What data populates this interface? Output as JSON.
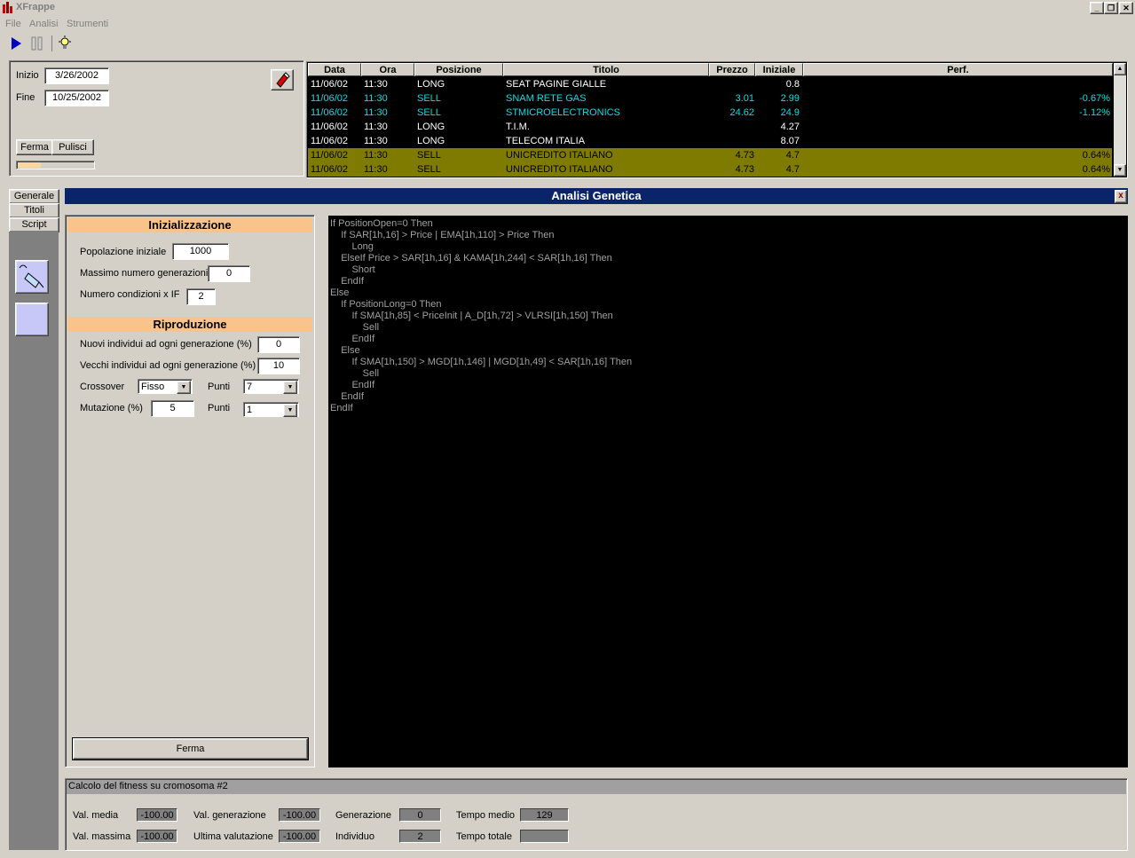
{
  "window": {
    "title": "XFrappe"
  },
  "menu": [
    "File",
    "Analisi",
    "Strumenti"
  ],
  "controls": {
    "inizio_label": "Inizio",
    "inizio_value": "3/26/2002",
    "fine_label": "Fine",
    "fine_value": "10/25/2002",
    "ferma_label": "Ferma",
    "pulisci_label": "Pulisci",
    "progress": 0.3
  },
  "ticker": {
    "columns": [
      "Data",
      "Ora",
      "Posizione",
      "Titolo",
      "Prezzo",
      "Iniziale",
      "Perf."
    ],
    "rows": [
      {
        "data": "11/06/02",
        "ora": "11:30",
        "pos": "LONG",
        "titolo": "SEAT PAGINE GIALLE",
        "prezzo": "",
        "iniziale": "0.8",
        "perf": "",
        "color": "#ffffff",
        "highlight": false
      },
      {
        "data": "11/06/02",
        "ora": "11:30",
        "pos": "SELL",
        "titolo": "SNAM RETE GAS",
        "prezzo": "3.01",
        "iniziale": "2.99",
        "perf": "-0.67%",
        "color": "#00e0e0",
        "highlight": false
      },
      {
        "data": "11/06/02",
        "ora": "11:30",
        "pos": "SELL",
        "titolo": "STMICROELECTRONICS",
        "prezzo": "24.62",
        "iniziale": "24.9",
        "perf": "-1.12%",
        "color": "#00e0e0",
        "highlight": false
      },
      {
        "data": "11/06/02",
        "ora": "11:30",
        "pos": "LONG",
        "titolo": "T.I.M.",
        "prezzo": "",
        "iniziale": "4.27",
        "perf": "",
        "color": "#ffffff",
        "highlight": false
      },
      {
        "data": "11/06/02",
        "ora": "11:30",
        "pos": "LONG",
        "titolo": "TELECOM ITALIA",
        "prezzo": "",
        "iniziale": "8.07",
        "perf": "",
        "color": "#ffffff",
        "highlight": false
      },
      {
        "data": "11/06/02",
        "ora": "11:30",
        "pos": "SELL",
        "titolo": "UNICREDITO ITALIANO",
        "prezzo": "4.73",
        "iniziale": "4.7",
        "perf": "0.64%",
        "color": "#000000",
        "highlight": true
      },
      {
        "data": "11/06/02",
        "ora": "11:30",
        "pos": "SELL",
        "titolo": "UNICREDITO ITALIANO",
        "prezzo": "4.73",
        "iniziale": "4.7",
        "perf": "0.64%",
        "color": "#000000",
        "highlight": true
      }
    ]
  },
  "side_tabs": [
    "Generale",
    "Titoli",
    "Script"
  ],
  "panel": {
    "title": "Analisi Genetica",
    "close_label": "x",
    "init_header": "Inizializzazione",
    "popolazione_label": "Popolazione iniziale",
    "popolazione_value": "1000",
    "max_gen_label": "Massimo numero generazioni",
    "max_gen_value": "0",
    "num_cond_label": "Numero condizioni x IF",
    "num_cond_value": "2",
    "repro_header": "Riproduzione",
    "nuovi_label": "Nuovi individui ad ogni generazione (%)",
    "nuovi_value": "0",
    "vecchi_label": "Vecchi individui ad ogni generazione (%)",
    "vecchi_value": "10",
    "crossover_label": "Crossover",
    "crossover_value": "Fisso",
    "punti1_label": "Punti",
    "punti1_value": "7",
    "mutazione_label": "Mutazione (%)",
    "mutazione_value": "5",
    "punti2_label": "Punti",
    "punti2_value": "1",
    "ferma_label": "Ferma"
  },
  "code": "If PositionOpen=0 Then\n    If SAR[1h,16] > Price | EMA[1h,110] > Price Then\n        Long\n    ElseIf Price > SAR[1h,16] & KAMA[1h,244] < SAR[1h,16] Then\n        Short\n    EndIf\nElse\n    If PositionLong=0 Then\n        If SMA[1h,85] < PriceInit | A_D[1h,72] > VLRSI[1h,150] Then\n            Sell\n        EndIf\n    Else\n        If SMA[1h,150] > MGD[1h,146] | MGD[1h,49] < SAR[1h,16] Then\n            Sell\n        EndIf\n    EndIf\nEndIf",
  "status": {
    "message": "Calcolo del fitness su cromosoma #2",
    "val_media_label": "Val. media",
    "val_media": "-100.00",
    "val_massima_label": "Val. massima",
    "val_massima": "-100.00",
    "val_gen_label": "Val. generazione",
    "val_gen": "-100.00",
    "ultima_label": "Ultima valutazione",
    "ultima": "-100.00",
    "generazione_label": "Generazione",
    "generazione": "0",
    "individuo_label": "Individuo",
    "individuo": "2",
    "tempo_medio_label": "Tempo medio",
    "tempo_medio": "129",
    "tempo_totale_label": "Tempo totale",
    "tempo_totale": ""
  },
  "icons": [
    "app-icon",
    "play-icon",
    "pause-icon",
    "lightbulb-icon",
    "eraser-icon",
    "paint-tool-icon",
    "blank-tool-icon"
  ]
}
